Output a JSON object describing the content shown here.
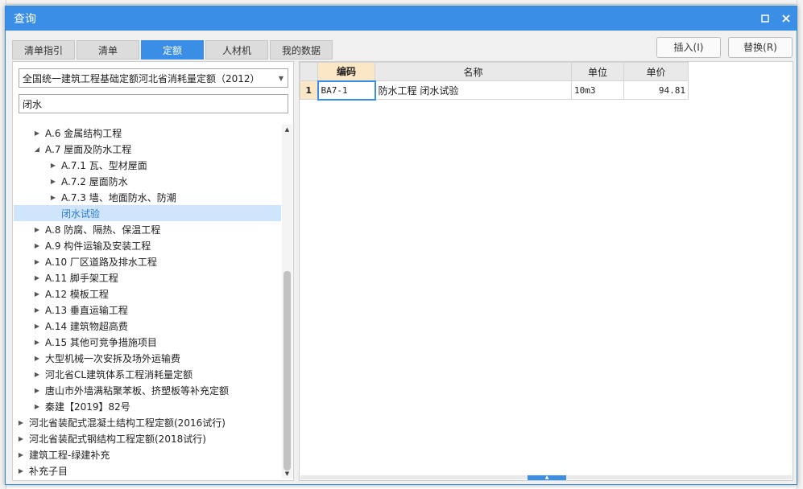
{
  "window": {
    "title": "查询"
  },
  "tabs": [
    {
      "label": "清单指引"
    },
    {
      "label": "清单"
    },
    {
      "label": "定额"
    },
    {
      "label": "人材机"
    },
    {
      "label": "我的数据"
    }
  ],
  "active_tab": "定额",
  "actions": {
    "insert": "插入(I)",
    "replace": "替换(R)"
  },
  "library": {
    "selected": "全国统一建筑工程基础定额河北省消耗量定额（2012）"
  },
  "search": {
    "value": "闭水",
    "placeholder": "闭水"
  },
  "tree": [
    {
      "label": "A.6 金属结构工程",
      "expanded": false
    },
    {
      "label": "A.7 屋面及防水工程",
      "expanded": true
    },
    {
      "label": "A.7.1 瓦、型材屋面",
      "expanded": false
    },
    {
      "label": "A.7.2 屋面防水",
      "expanded": false
    },
    {
      "label": "A.7.3 墙、地面防水、防潮",
      "expanded": false
    },
    {
      "label": "闭水试验",
      "selected": true
    },
    {
      "label": "A.8 防腐、隔热、保温工程",
      "expanded": false
    },
    {
      "label": "A.9 构件运输及安装工程",
      "expanded": false
    },
    {
      "label": "A.10 厂区道路及排水工程",
      "expanded": false
    },
    {
      "label": "A.11 脚手架工程",
      "expanded": false
    },
    {
      "label": "A.12 模板工程",
      "expanded": false
    },
    {
      "label": "A.13 垂直运输工程",
      "expanded": false
    },
    {
      "label": "A.14 建筑物超高费",
      "expanded": false
    },
    {
      "label": "A.15 其他可竞争措施项目",
      "expanded": false
    },
    {
      "label": "大型机械一次安拆及场外运输费",
      "expanded": false
    },
    {
      "label": "河北省CL建筑体系工程消耗量定额",
      "expanded": false
    },
    {
      "label": "唐山市外墙满粘聚苯板、挤塑板等补充定额",
      "expanded": false
    },
    {
      "label": "秦建【2019】82号",
      "expanded": false
    },
    {
      "label": "河北省装配式混凝土结构工程定额(2016试行)",
      "expanded": false
    },
    {
      "label": "河北省装配式钢结构工程定额(2018试行)",
      "expanded": false
    },
    {
      "label": "建筑工程-绿建补充",
      "expanded": false
    },
    {
      "label": "补充子目",
      "expanded": false
    }
  ],
  "grid": {
    "columns": [
      "编码",
      "名称",
      "单位",
      "单价"
    ],
    "rows": [
      {
        "num": "1",
        "code": "BA7-1",
        "name": "防水工程 闭水试验",
        "unit": "10m3",
        "price": "94.81"
      }
    ]
  },
  "colors": {
    "accent": "#3a8ee6",
    "header_highlight": "#fbe7c6",
    "selection": "#cfe5fb"
  }
}
